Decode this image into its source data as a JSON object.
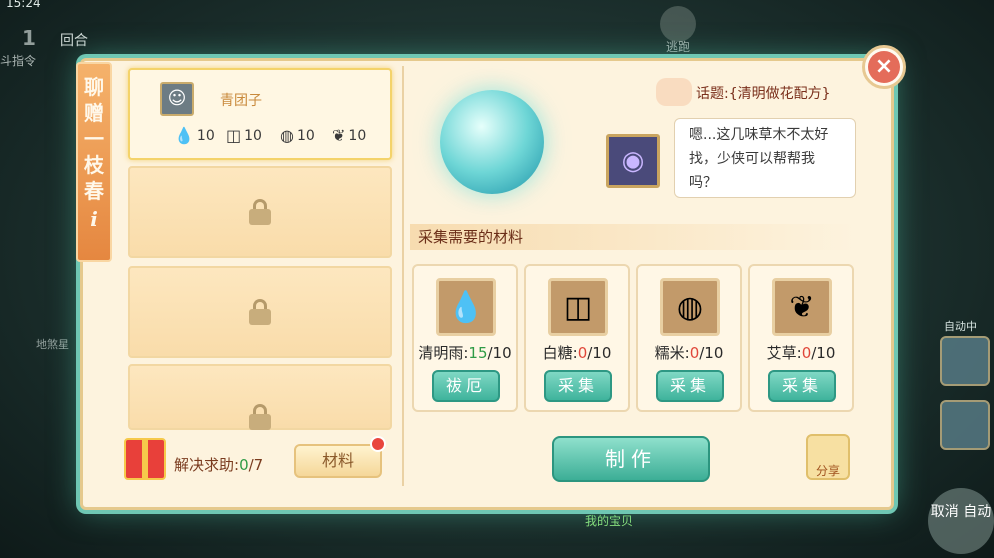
{
  "hud": {
    "time": "15:24",
    "round_num": "1",
    "round_label": "回合",
    "command_label": "斗指令",
    "escape_label": "逃跑",
    "auto_label": "自动中",
    "auto_button": "取消 自动",
    "treasure_label": "我的宝贝",
    "map_label": "地煞星"
  },
  "panel": {
    "side_title": "聊赠一枝春",
    "side_info": "i",
    "close": "×"
  },
  "requests": [
    {
      "name": "青团子",
      "avatar": "☺",
      "requirements": [
        {
          "icon": "water-drop-icon",
          "glyph": "💧",
          "qty": "10"
        },
        {
          "icon": "sugar-icon",
          "glyph": "◫",
          "qty": "10"
        },
        {
          "icon": "rice-icon",
          "glyph": "◍",
          "qty": "10"
        },
        {
          "icon": "mugwort-icon",
          "glyph": "❦",
          "qty": "10"
        }
      ]
    }
  ],
  "help": {
    "label": "解决求助:",
    "done": "0",
    "total": "/7"
  },
  "materials_button": "材料",
  "topic": "话题:{清明做花配方}",
  "npc": {
    "portrait": "◉",
    "dialogue": "嗯...这几味草木不太好找，少侠可以帮帮我吗？"
  },
  "section_title": "采集需要的材料",
  "materials": [
    {
      "name": "清明雨:",
      "have": "15",
      "need": "/10",
      "ok": true,
      "glyph": "💧",
      "action": "祓厄"
    },
    {
      "name": "白糖:",
      "have": "0",
      "need": "/10",
      "ok": false,
      "glyph": "◫",
      "action": "采集"
    },
    {
      "name": "糯米:",
      "have": "0",
      "need": "/10",
      "ok": false,
      "glyph": "◍",
      "action": "采集"
    },
    {
      "name": "艾草:",
      "have": "0",
      "need": "/10",
      "ok": false,
      "glyph": "❦",
      "action": "采集"
    }
  ],
  "make_button": "制作",
  "share_button": "分享",
  "colors": {
    "accent": "#3fb39c",
    "ok": "#2f9b46",
    "bad": "#e0473a",
    "panel": "#fdf3de"
  }
}
